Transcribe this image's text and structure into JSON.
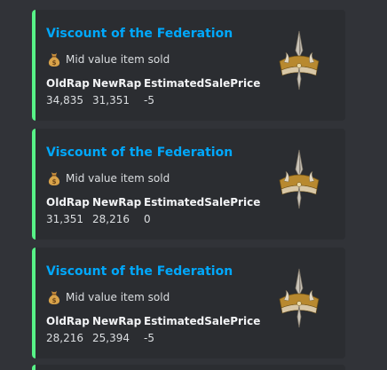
{
  "embeds": [
    {
      "title": "Viscount of the Federation",
      "description": "Mid value item sold",
      "fields": [
        {
          "name": "OldRap",
          "value": "34,835"
        },
        {
          "name": "NewRap",
          "value": "31,351"
        },
        {
          "name": "EstimatedSalePrice",
          "value": "-5"
        }
      ]
    },
    {
      "title": "Viscount of the Federation",
      "description": "Mid value item sold",
      "fields": [
        {
          "name": "OldRap",
          "value": "31,351"
        },
        {
          "name": "NewRap",
          "value": "28,216"
        },
        {
          "name": "EstimatedSalePrice",
          "value": "0"
        }
      ]
    },
    {
      "title": "Viscount of the Federation",
      "description": "Mid value item sold",
      "fields": [
        {
          "name": "OldRap",
          "value": "28,216"
        },
        {
          "name": "NewRap",
          "value": "25,394"
        },
        {
          "name": "EstimatedSalePrice",
          "value": "-5"
        }
      ]
    }
  ],
  "colors": {
    "background": "#313338",
    "embed_background": "#2b2d31",
    "accent_bar": "#57f287",
    "title_link": "#00a8fc"
  },
  "icons": {
    "description_emoji": "money-bag-icon",
    "thumbnail": "crown-icon"
  }
}
